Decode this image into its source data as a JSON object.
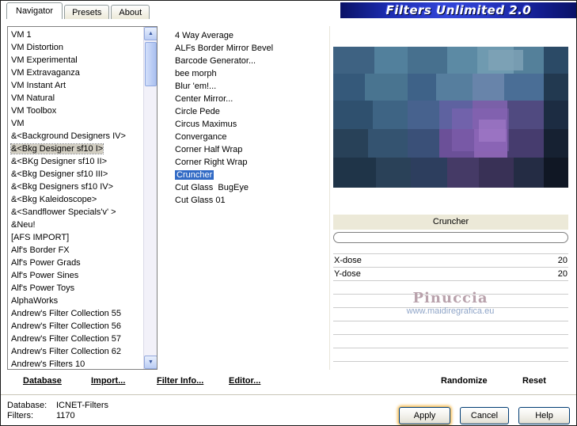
{
  "window": {
    "title": "Filters Unlimited 2.0",
    "tabs": {
      "navigator": "Navigator",
      "presets": "Presets",
      "about": "About"
    }
  },
  "icons": {
    "scroll_up": "▲",
    "scroll_down": "▼"
  },
  "categories": {
    "selected_index": 9,
    "items": [
      "VM 1",
      "VM Distortion",
      "VM Experimental",
      "VM Extravaganza",
      "VM Instant Art",
      "VM Natural",
      "VM Toolbox",
      "VM",
      "&<Background Designers IV>",
      "&<Bkg Designer sf10 I>",
      "&<BKg Designer sf10 II>",
      "&<Bkg Designer sf10 III>",
      "&<Bkg Designers sf10 IV>",
      "&<Bkg Kaleidoscope>",
      "&<Sandflower Specials'v' >",
      "&Neu!",
      "[AFS IMPORT]",
      "Alf's Border FX",
      "Alf's Power Grads",
      "Alf's Power Sines",
      "Alf's Power Toys",
      "AlphaWorks",
      "Andrew's Filter Collection 55",
      "Andrew's Filter Collection 56",
      "Andrew's Filter Collection 57",
      "Andrew's Filter Collection 62",
      "Andrew's Filters 10"
    ]
  },
  "filters": {
    "selected_index": 11,
    "items": [
      "4 Way Average",
      "ALFs Border Mirror Bevel",
      "Barcode Generator...",
      "bee morph",
      "Blur 'em!...",
      "Center Mirror...",
      "Circle Pede",
      "Circus Maximus",
      "Convergance",
      "Corner Half Wrap",
      "Corner Right Wrap",
      "Cruncher",
      "Cut Glass  BugEye",
      "Cut Glass 01"
    ]
  },
  "preview": {
    "active_filter": "Cruncher",
    "sliders": [
      {
        "label": "X-dose",
        "value": "20"
      },
      {
        "label": "Y-dose",
        "value": "20"
      }
    ],
    "watermark": {
      "name": "Pinuccia",
      "url": "www.maidiregrafica.eu"
    }
  },
  "toolbar": {
    "database": "Database",
    "import": "Import...",
    "filter_info": "Filter Info...",
    "editor": "Editor...",
    "randomize": "Randomize",
    "reset": "Reset"
  },
  "status": {
    "database_label": "Database:",
    "database_value": "ICNET-Filters",
    "filters_label": "Filters:",
    "filters_value": "1170"
  },
  "buttons": {
    "apply": "Apply",
    "cancel": "Cancel",
    "help": "Help"
  },
  "colors": {
    "selection_blue": "#316ac5",
    "banner_blue": "#2838c4",
    "panel_beige": "#ece9d8",
    "apply_glow": "#f5b848"
  }
}
